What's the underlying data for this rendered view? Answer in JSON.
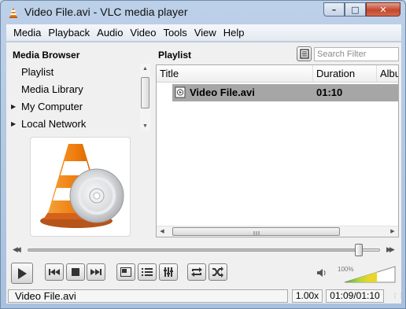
{
  "window": {
    "title": "Video File.avi - VLC media player",
    "controls": {
      "minimize": "–",
      "maximize": "□",
      "close": "✕"
    },
    "accent_color": "#f07f10"
  },
  "menu": [
    "Media",
    "Playback",
    "Audio",
    "Video",
    "Tools",
    "View",
    "Help"
  ],
  "media_browser": {
    "heading": "Media Browser",
    "items": [
      {
        "label": "Playlist",
        "expandable": false
      },
      {
        "label": "Media Library",
        "expandable": false
      },
      {
        "label": "My Computer",
        "expandable": true
      },
      {
        "label": "Local Network",
        "expandable": true
      }
    ],
    "art_icon": "vlc-cone-with-disc"
  },
  "playlist": {
    "heading": "Playlist",
    "search_placeholder": "Search Filter",
    "columns": [
      "Title",
      "Duration",
      "Album"
    ],
    "rows": [
      {
        "title": "Video File.avi",
        "duration": "01:10",
        "selected": true
      }
    ]
  },
  "seek": {
    "position_fraction": 0.94
  },
  "controls": {
    "buttons": [
      "play-icon",
      "previous-icon",
      "stop-icon",
      "next-icon",
      "fullscreen-icon",
      "playlist-icon",
      "extended-settings-icon",
      "loop-icon",
      "shuffle-icon"
    ]
  },
  "volume": {
    "label": "100%",
    "level": 1.0
  },
  "status": {
    "file": "Video File.avi",
    "speed": "1.00x",
    "time": "01:09/01:10"
  }
}
